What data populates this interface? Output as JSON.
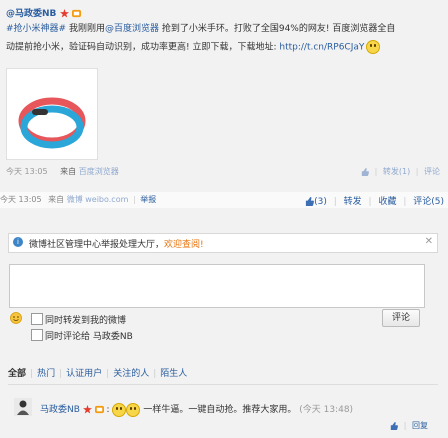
{
  "repost": {
    "author": "@马政委NB",
    "hashtag": "#抢小米神器#",
    "text_a": " 我刚刚用",
    "mention": "@百度浏览器",
    "text_b": " 抢到了小米手环。打败了全国94%的网友! 百度浏览器全自",
    "text_c": "动提前抢小米，验证码自动识别，成功率更高! 立即下载，下载地址: ",
    "url": "http://t.cn/RP6CJaY",
    "time": "今天 13:05",
    "from_label": "来自",
    "source": "百度浏览器",
    "actions": {
      "repost": "转发(1)",
      "comment": "评论"
    }
  },
  "status": {
    "time": "今天 13:05",
    "from_label": "来自",
    "source": "微博 weibo.com",
    "report": "举报",
    "like": "(3)",
    "repost": "转发",
    "favorite": "收藏",
    "comment": "评论(5)"
  },
  "notice": {
    "text": "微博社区管理中心举报处理大厅，",
    "link": "欢迎查阅!",
    "close": "✕"
  },
  "compose": {
    "also_repost": "同时转发到我的微博",
    "also_comment": "同时评论给 马政委NB",
    "submit": "评论"
  },
  "tabs": [
    "全部",
    "热门",
    "认证用户",
    "关注的人",
    "陌生人"
  ],
  "comment": {
    "author": "马政委NB",
    "colon": ":",
    "text": "一样牛逼。一键自动抢。推荐大家用。",
    "time": "(今天 13:48)",
    "reply": "回复"
  },
  "colors": {
    "link": "#2a5d9f",
    "accent": "#e8730c"
  }
}
